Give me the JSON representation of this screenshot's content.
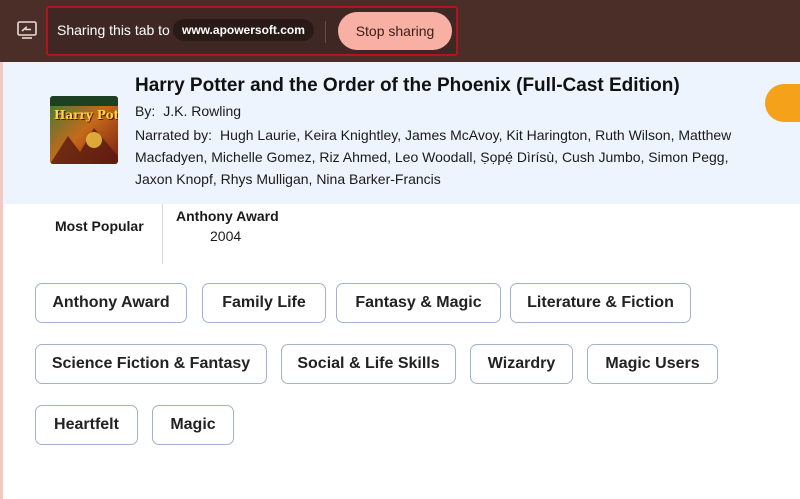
{
  "sharing_bar": {
    "message": "Sharing this tab to",
    "domain": "www.apowersoft.com",
    "stop_label": "Stop sharing",
    "colors": {
      "bar": "#4b2e28",
      "stop_button": "#f7b0a3",
      "highlight_border": "#b3141d"
    },
    "icon": "screen-share-icon"
  },
  "book": {
    "title": "Harry Potter and the Order of the Phoenix (Full-Cast Edition)",
    "by_label": "By:",
    "author": "J.K. Rowling",
    "narrated_label": "Narrated by:",
    "narrators_text": "Hugh Laurie, Keira Knightley, James McAvoy, Kit Harington, Ruth Wilson, Matthew Macfadyen, Michelle Gomez, Riz Ahmed, Leo Woodall, Ṣọpẹ́ Dìrísù, Cush Jumbo, Simon Pegg, Jaxon Knopf, Rhys Mulligan, Nina Barker-Francis",
    "cover_text": "Harry Potter",
    "accent_color": "#f5a21a"
  },
  "stats": {
    "most_popular_label": "Most Popular",
    "award_name": "Anthony Award",
    "award_year": "2004"
  },
  "tags": [
    "Anthony Award",
    "Family Life",
    "Fantasy & Magic",
    "Literature & Fiction",
    "Science Fiction & Fantasy",
    "Social & Life Skills",
    "Wizardry",
    "Magic Users",
    "Heartfelt",
    "Magic"
  ]
}
